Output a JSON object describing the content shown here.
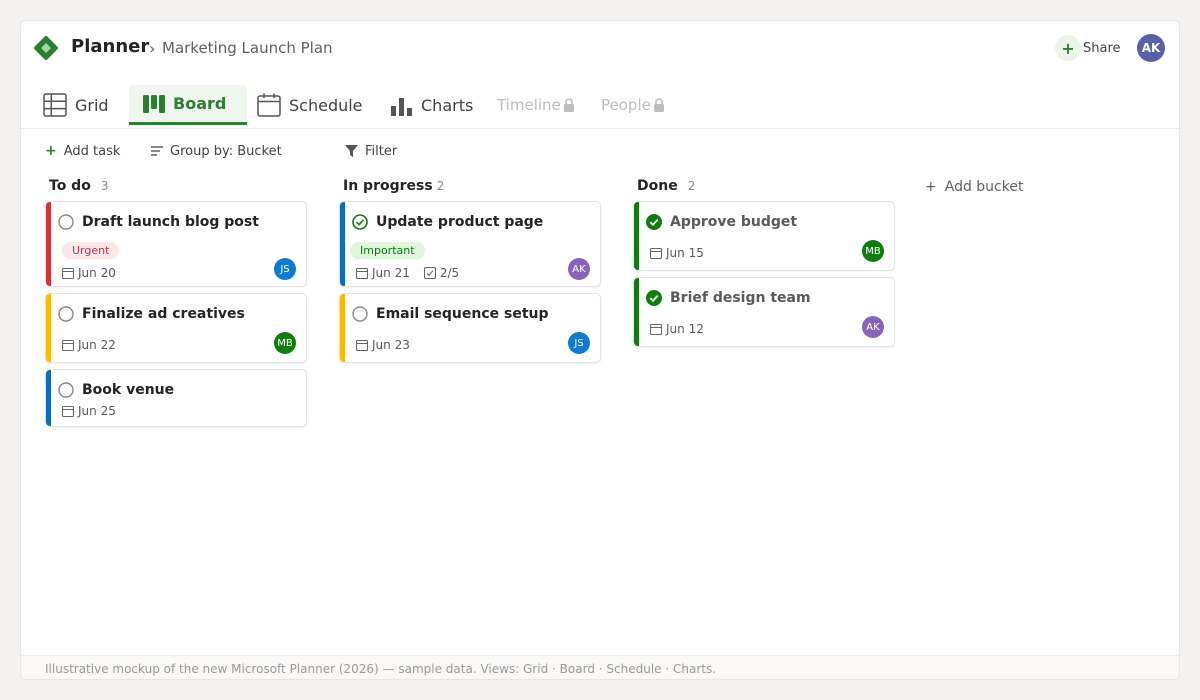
{
  "app": {
    "title": "Planner",
    "breadcrumb_sep": "›",
    "plan_name": "Marketing Launch Plan",
    "share_label": "Share",
    "user_initials": "AK",
    "accent_color": "#2e7d32"
  },
  "tabs": [
    {
      "label": "Grid",
      "icon": "grid-icon",
      "state": "normal"
    },
    {
      "label": "Board",
      "icon": "board-icon",
      "state": "active"
    },
    {
      "label": "Schedule",
      "icon": "calendar-icon",
      "state": "normal"
    },
    {
      "label": "Charts",
      "icon": "bar-chart-icon",
      "state": "normal"
    },
    {
      "label": "Timeline",
      "icon": "lock-icon",
      "state": "locked"
    },
    {
      "label": "People",
      "icon": "lock-icon",
      "state": "locked"
    }
  ],
  "toolbar": {
    "add_task": "Add task",
    "group_by": "Group by: Bucket",
    "filter": "Filter"
  },
  "buckets": [
    {
      "name": "To do",
      "count": "3",
      "cards": [
        {
          "title": "Draft launch blog post",
          "status": "open",
          "color": "#d13438",
          "label": "Urgent",
          "label_bg": "#fde7e9",
          "label_fg": "#c4314b",
          "due": "Jun 20",
          "checklist": "",
          "assignee": "JS",
          "assignee_color": "#0f7bd0"
        },
        {
          "title": "Finalize ad creatives",
          "status": "open",
          "color": "#ffb900",
          "label": "",
          "due": "Jun 22",
          "checklist": "",
          "assignee": "MB",
          "assignee_color": "#107c10"
        },
        {
          "title": "Book venue",
          "status": "open",
          "color": "#0f6cbd",
          "label": "",
          "due": "Jun 25",
          "checklist": "",
          "assignee": "",
          "assignee_color": ""
        }
      ]
    },
    {
      "name": "In progress",
      "count": "2",
      "cards": [
        {
          "title": "Update product page",
          "status": "in-progress",
          "color": "#0f6cbd",
          "label": "Important",
          "label_bg": "#dff6dd",
          "label_fg": "#107c10",
          "due": "Jun 21",
          "checklist": "2/5",
          "assignee": "AK",
          "assignee_color": "#8764b8"
        },
        {
          "title": "Email sequence setup",
          "status": "open",
          "color": "#ffb900",
          "label": "",
          "due": "Jun 23",
          "checklist": "",
          "assignee": "JS",
          "assignee_color": "#0f7bd0"
        }
      ]
    },
    {
      "name": "Done",
      "count": "2",
      "cards": [
        {
          "title": "Approve budget",
          "status": "done",
          "color": "#107c10",
          "label": "",
          "due": "Jun 15",
          "checklist": "",
          "assignee": "MB",
          "assignee_color": "#107c10"
        },
        {
          "title": "Brief design team",
          "status": "done",
          "color": "#107c10",
          "label": "",
          "due": "Jun 12",
          "checklist": "",
          "assignee": "AK",
          "assignee_color": "#8764b8"
        }
      ]
    }
  ],
  "add_bucket": "Add bucket",
  "footer": "Illustrative mockup of the new Microsoft Planner (2026) — sample data. Views: Grid · Board · Schedule · Charts."
}
